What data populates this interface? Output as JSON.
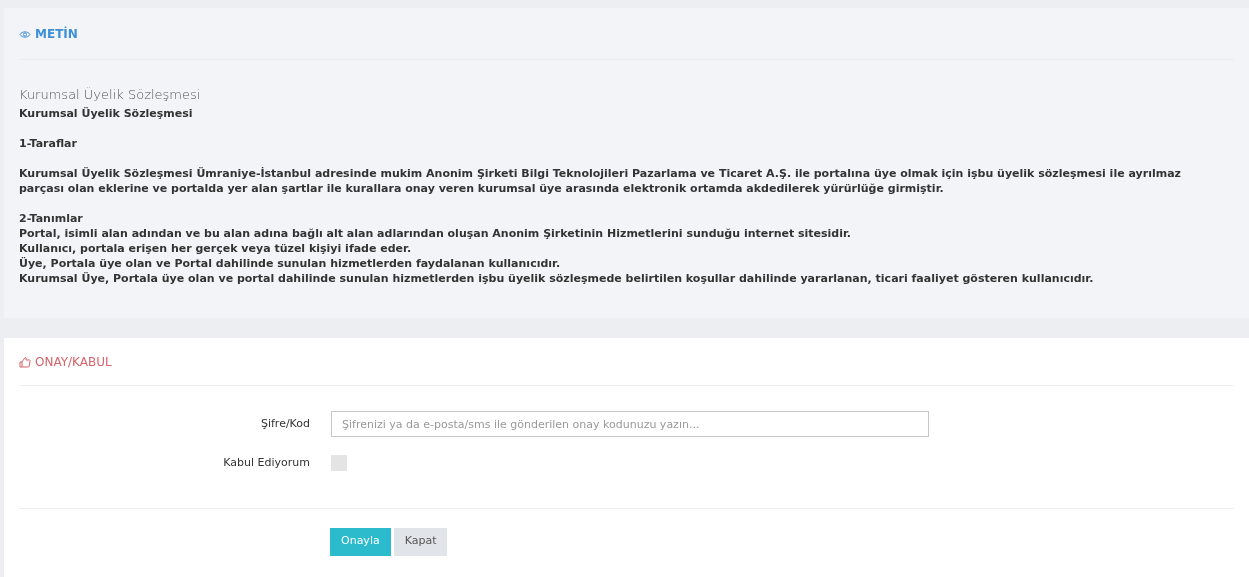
{
  "text_panel": {
    "header": "METİN",
    "title": "Kurumsal Üyelik Sözleşmesi",
    "paragraphs": [
      [
        "Kurumsal Üyelik Sözleşmesi"
      ],
      [
        "1-Taraflar"
      ],
      [
        "Kurumsal Üyelik Sözleşmesi Ümraniye-İstanbul adresinde mukim Anonim Şirketi Bilgi Teknolojileri Pazarlama ve Ticaret A.Ş. ile portalına üye olmak için işbu üyelik sözleşmesi ile ayrılmaz parçası olan eklerine ve portalda yer alan şartlar ile kurallara onay veren kurumsal üye arasında elektronik ortamda akdedilerek yürürlüğe girmiştir."
      ],
      [
        "2-Tanımlar",
        "Portal, isimli alan adından ve bu alan adına bağlı alt alan adlarından oluşan Anonim Şirketinin Hizmetlerini sunduğu internet sitesidir.",
        "Kullanıcı, portala erişen her gerçek veya tüzel kişiyi ifade eder.",
        "Üye, Portala üye olan ve Portal dahilinde sunulan hizmetlerden faydalanan kullanıcıdır.",
        "Kurumsal Üye, Portala üye olan ve portal dahilinde sunulan hizmetlerden işbu üyelik sözleşmede belirtilen koşullar dahilinde yararlanan, ticari faaliyet gösteren kullanıcıdır."
      ]
    ]
  },
  "approval_panel": {
    "header": "ONAY/KABUL",
    "code_field": {
      "label": "Şifre/Kod",
      "placeholder": "Şifrenizi ya da e-posta/sms ile gönderilen onay kodunuzu yazın..."
    },
    "accept": {
      "label": "Kabul Ediyorum",
      "checked": false
    },
    "buttons": [
      {
        "label": "Onayla",
        "kind": "primary"
      },
      {
        "label": "Kapat",
        "kind": "secondary"
      }
    ]
  }
}
